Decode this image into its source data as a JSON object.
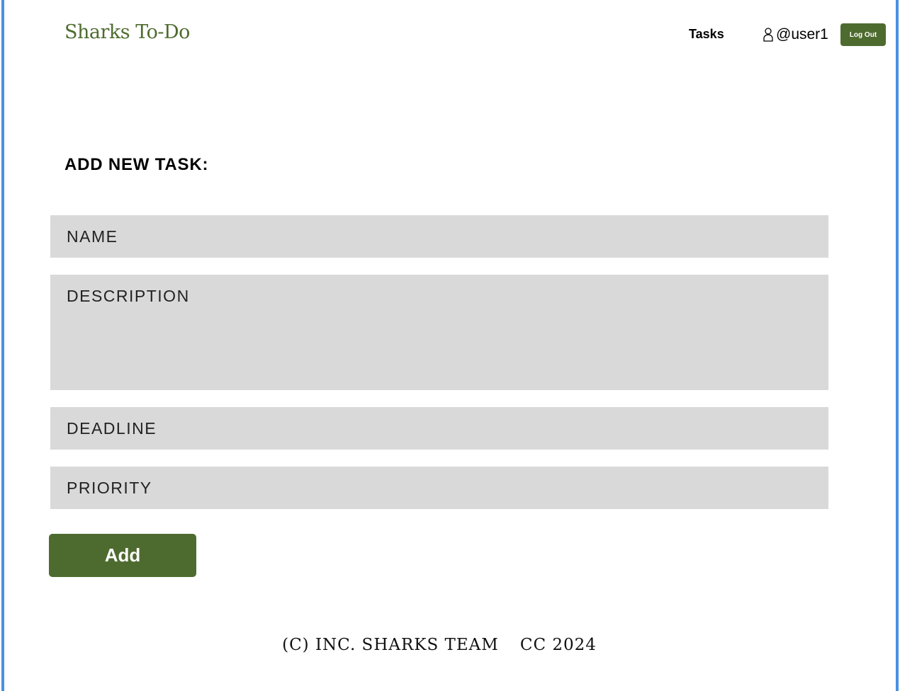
{
  "header": {
    "brand": "Sharks To-Do",
    "nav": {
      "tasks_label": "Tasks"
    },
    "user": {
      "icon": "user-icon",
      "username": "@user1"
    },
    "logout_label": "Log Out"
  },
  "form": {
    "title": "ADD NEW TASK:",
    "fields": {
      "name_placeholder": "NAME",
      "description_placeholder": "DESCRIPTION",
      "deadline_placeholder": "DEADLINE",
      "priority_placeholder": "PRIORITY"
    },
    "submit_label": "Add"
  },
  "footer": {
    "left": "(C) INC. SHARKS TEAM",
    "right": "CC 2024"
  },
  "colors": {
    "accent": "#4e6b2f",
    "field_bg": "#d9d9d9",
    "frame": "#4a90e2"
  }
}
